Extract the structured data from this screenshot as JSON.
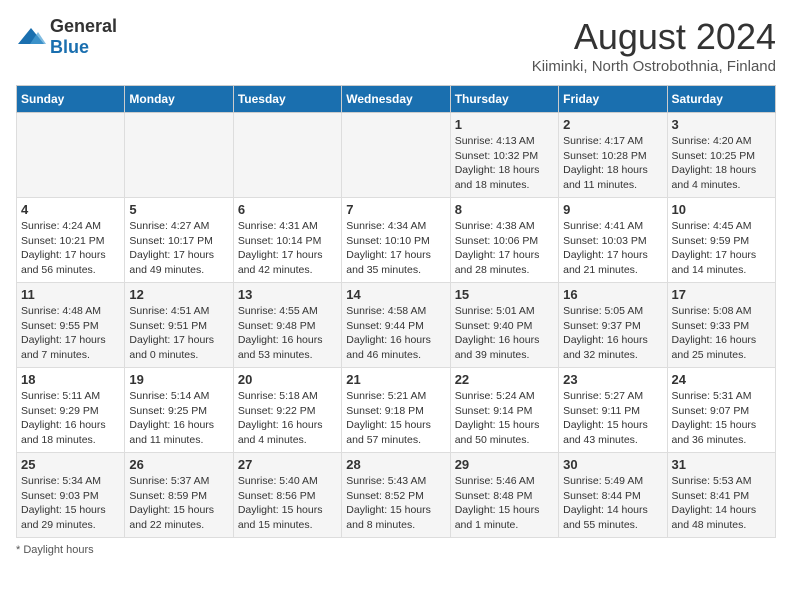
{
  "header": {
    "logo_general": "General",
    "logo_blue": "Blue",
    "title": "August 2024",
    "subtitle": "Kiiminki, North Ostrobothnia, Finland"
  },
  "days_of_week": [
    "Sunday",
    "Monday",
    "Tuesday",
    "Wednesday",
    "Thursday",
    "Friday",
    "Saturday"
  ],
  "weeks": [
    [
      {
        "day": "",
        "detail": ""
      },
      {
        "day": "",
        "detail": ""
      },
      {
        "day": "",
        "detail": ""
      },
      {
        "day": "",
        "detail": ""
      },
      {
        "day": "1",
        "detail": "Sunrise: 4:13 AM\nSunset: 10:32 PM\nDaylight: 18 hours\nand 18 minutes."
      },
      {
        "day": "2",
        "detail": "Sunrise: 4:17 AM\nSunset: 10:28 PM\nDaylight: 18 hours\nand 11 minutes."
      },
      {
        "day": "3",
        "detail": "Sunrise: 4:20 AM\nSunset: 10:25 PM\nDaylight: 18 hours\nand 4 minutes."
      }
    ],
    [
      {
        "day": "4",
        "detail": "Sunrise: 4:24 AM\nSunset: 10:21 PM\nDaylight: 17 hours\nand 56 minutes."
      },
      {
        "day": "5",
        "detail": "Sunrise: 4:27 AM\nSunset: 10:17 PM\nDaylight: 17 hours\nand 49 minutes."
      },
      {
        "day": "6",
        "detail": "Sunrise: 4:31 AM\nSunset: 10:14 PM\nDaylight: 17 hours\nand 42 minutes."
      },
      {
        "day": "7",
        "detail": "Sunrise: 4:34 AM\nSunset: 10:10 PM\nDaylight: 17 hours\nand 35 minutes."
      },
      {
        "day": "8",
        "detail": "Sunrise: 4:38 AM\nSunset: 10:06 PM\nDaylight: 17 hours\nand 28 minutes."
      },
      {
        "day": "9",
        "detail": "Sunrise: 4:41 AM\nSunset: 10:03 PM\nDaylight: 17 hours\nand 21 minutes."
      },
      {
        "day": "10",
        "detail": "Sunrise: 4:45 AM\nSunset: 9:59 PM\nDaylight: 17 hours\nand 14 minutes."
      }
    ],
    [
      {
        "day": "11",
        "detail": "Sunrise: 4:48 AM\nSunset: 9:55 PM\nDaylight: 17 hours\nand 7 minutes."
      },
      {
        "day": "12",
        "detail": "Sunrise: 4:51 AM\nSunset: 9:51 PM\nDaylight: 17 hours\nand 0 minutes."
      },
      {
        "day": "13",
        "detail": "Sunrise: 4:55 AM\nSunset: 9:48 PM\nDaylight: 16 hours\nand 53 minutes."
      },
      {
        "day": "14",
        "detail": "Sunrise: 4:58 AM\nSunset: 9:44 PM\nDaylight: 16 hours\nand 46 minutes."
      },
      {
        "day": "15",
        "detail": "Sunrise: 5:01 AM\nSunset: 9:40 PM\nDaylight: 16 hours\nand 39 minutes."
      },
      {
        "day": "16",
        "detail": "Sunrise: 5:05 AM\nSunset: 9:37 PM\nDaylight: 16 hours\nand 32 minutes."
      },
      {
        "day": "17",
        "detail": "Sunrise: 5:08 AM\nSunset: 9:33 PM\nDaylight: 16 hours\nand 25 minutes."
      }
    ],
    [
      {
        "day": "18",
        "detail": "Sunrise: 5:11 AM\nSunset: 9:29 PM\nDaylight: 16 hours\nand 18 minutes."
      },
      {
        "day": "19",
        "detail": "Sunrise: 5:14 AM\nSunset: 9:25 PM\nDaylight: 16 hours\nand 11 minutes."
      },
      {
        "day": "20",
        "detail": "Sunrise: 5:18 AM\nSunset: 9:22 PM\nDaylight: 16 hours\nand 4 minutes."
      },
      {
        "day": "21",
        "detail": "Sunrise: 5:21 AM\nSunset: 9:18 PM\nDaylight: 15 hours\nand 57 minutes."
      },
      {
        "day": "22",
        "detail": "Sunrise: 5:24 AM\nSunset: 9:14 PM\nDaylight: 15 hours\nand 50 minutes."
      },
      {
        "day": "23",
        "detail": "Sunrise: 5:27 AM\nSunset: 9:11 PM\nDaylight: 15 hours\nand 43 minutes."
      },
      {
        "day": "24",
        "detail": "Sunrise: 5:31 AM\nSunset: 9:07 PM\nDaylight: 15 hours\nand 36 minutes."
      }
    ],
    [
      {
        "day": "25",
        "detail": "Sunrise: 5:34 AM\nSunset: 9:03 PM\nDaylight: 15 hours\nand 29 minutes."
      },
      {
        "day": "26",
        "detail": "Sunrise: 5:37 AM\nSunset: 8:59 PM\nDaylight: 15 hours\nand 22 minutes."
      },
      {
        "day": "27",
        "detail": "Sunrise: 5:40 AM\nSunset: 8:56 PM\nDaylight: 15 hours\nand 15 minutes."
      },
      {
        "day": "28",
        "detail": "Sunrise: 5:43 AM\nSunset: 8:52 PM\nDaylight: 15 hours\nand 8 minutes."
      },
      {
        "day": "29",
        "detail": "Sunrise: 5:46 AM\nSunset: 8:48 PM\nDaylight: 15 hours\nand 1 minute."
      },
      {
        "day": "30",
        "detail": "Sunrise: 5:49 AM\nSunset: 8:44 PM\nDaylight: 14 hours\nand 55 minutes."
      },
      {
        "day": "31",
        "detail": "Sunrise: 5:53 AM\nSunset: 8:41 PM\nDaylight: 14 hours\nand 48 minutes."
      }
    ]
  ],
  "footer": {
    "note": "Daylight hours"
  }
}
